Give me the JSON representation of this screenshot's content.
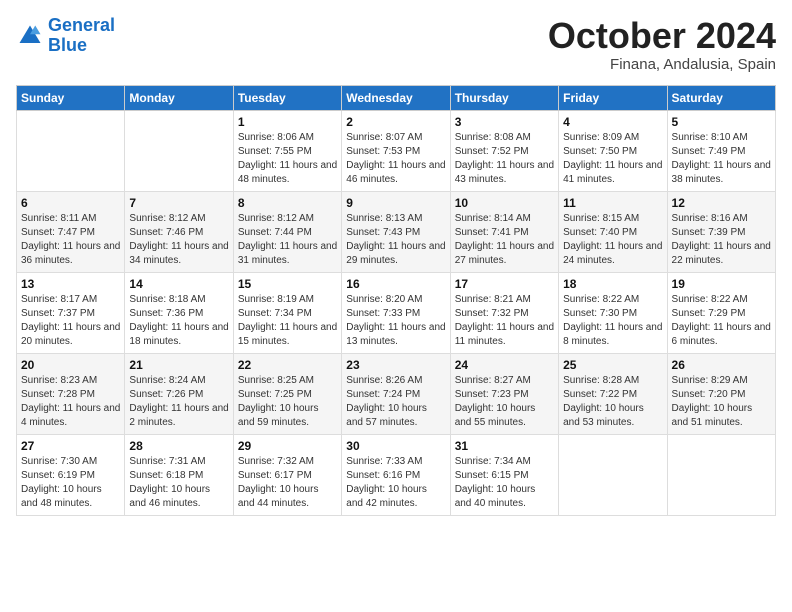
{
  "header": {
    "logo_line1": "General",
    "logo_line2": "Blue",
    "month": "October 2024",
    "location": "Finana, Andalusia, Spain"
  },
  "weekdays": [
    "Sunday",
    "Monday",
    "Tuesday",
    "Wednesday",
    "Thursday",
    "Friday",
    "Saturday"
  ],
  "weeks": [
    [
      {
        "day": "",
        "sunrise": "",
        "sunset": "",
        "daylight": ""
      },
      {
        "day": "",
        "sunrise": "",
        "sunset": "",
        "daylight": ""
      },
      {
        "day": "1",
        "sunrise": "Sunrise: 8:06 AM",
        "sunset": "Sunset: 7:55 PM",
        "daylight": "Daylight: 11 hours and 48 minutes."
      },
      {
        "day": "2",
        "sunrise": "Sunrise: 8:07 AM",
        "sunset": "Sunset: 7:53 PM",
        "daylight": "Daylight: 11 hours and 46 minutes."
      },
      {
        "day": "3",
        "sunrise": "Sunrise: 8:08 AM",
        "sunset": "Sunset: 7:52 PM",
        "daylight": "Daylight: 11 hours and 43 minutes."
      },
      {
        "day": "4",
        "sunrise": "Sunrise: 8:09 AM",
        "sunset": "Sunset: 7:50 PM",
        "daylight": "Daylight: 11 hours and 41 minutes."
      },
      {
        "day": "5",
        "sunrise": "Sunrise: 8:10 AM",
        "sunset": "Sunset: 7:49 PM",
        "daylight": "Daylight: 11 hours and 38 minutes."
      }
    ],
    [
      {
        "day": "6",
        "sunrise": "Sunrise: 8:11 AM",
        "sunset": "Sunset: 7:47 PM",
        "daylight": "Daylight: 11 hours and 36 minutes."
      },
      {
        "day": "7",
        "sunrise": "Sunrise: 8:12 AM",
        "sunset": "Sunset: 7:46 PM",
        "daylight": "Daylight: 11 hours and 34 minutes."
      },
      {
        "day": "8",
        "sunrise": "Sunrise: 8:12 AM",
        "sunset": "Sunset: 7:44 PM",
        "daylight": "Daylight: 11 hours and 31 minutes."
      },
      {
        "day": "9",
        "sunrise": "Sunrise: 8:13 AM",
        "sunset": "Sunset: 7:43 PM",
        "daylight": "Daylight: 11 hours and 29 minutes."
      },
      {
        "day": "10",
        "sunrise": "Sunrise: 8:14 AM",
        "sunset": "Sunset: 7:41 PM",
        "daylight": "Daylight: 11 hours and 27 minutes."
      },
      {
        "day": "11",
        "sunrise": "Sunrise: 8:15 AM",
        "sunset": "Sunset: 7:40 PM",
        "daylight": "Daylight: 11 hours and 24 minutes."
      },
      {
        "day": "12",
        "sunrise": "Sunrise: 8:16 AM",
        "sunset": "Sunset: 7:39 PM",
        "daylight": "Daylight: 11 hours and 22 minutes."
      }
    ],
    [
      {
        "day": "13",
        "sunrise": "Sunrise: 8:17 AM",
        "sunset": "Sunset: 7:37 PM",
        "daylight": "Daylight: 11 hours and 20 minutes."
      },
      {
        "day": "14",
        "sunrise": "Sunrise: 8:18 AM",
        "sunset": "Sunset: 7:36 PM",
        "daylight": "Daylight: 11 hours and 18 minutes."
      },
      {
        "day": "15",
        "sunrise": "Sunrise: 8:19 AM",
        "sunset": "Sunset: 7:34 PM",
        "daylight": "Daylight: 11 hours and 15 minutes."
      },
      {
        "day": "16",
        "sunrise": "Sunrise: 8:20 AM",
        "sunset": "Sunset: 7:33 PM",
        "daylight": "Daylight: 11 hours and 13 minutes."
      },
      {
        "day": "17",
        "sunrise": "Sunrise: 8:21 AM",
        "sunset": "Sunset: 7:32 PM",
        "daylight": "Daylight: 11 hours and 11 minutes."
      },
      {
        "day": "18",
        "sunrise": "Sunrise: 8:22 AM",
        "sunset": "Sunset: 7:30 PM",
        "daylight": "Daylight: 11 hours and 8 minutes."
      },
      {
        "day": "19",
        "sunrise": "Sunrise: 8:22 AM",
        "sunset": "Sunset: 7:29 PM",
        "daylight": "Daylight: 11 hours and 6 minutes."
      }
    ],
    [
      {
        "day": "20",
        "sunrise": "Sunrise: 8:23 AM",
        "sunset": "Sunset: 7:28 PM",
        "daylight": "Daylight: 11 hours and 4 minutes."
      },
      {
        "day": "21",
        "sunrise": "Sunrise: 8:24 AM",
        "sunset": "Sunset: 7:26 PM",
        "daylight": "Daylight: 11 hours and 2 minutes."
      },
      {
        "day": "22",
        "sunrise": "Sunrise: 8:25 AM",
        "sunset": "Sunset: 7:25 PM",
        "daylight": "Daylight: 10 hours and 59 minutes."
      },
      {
        "day": "23",
        "sunrise": "Sunrise: 8:26 AM",
        "sunset": "Sunset: 7:24 PM",
        "daylight": "Daylight: 10 hours and 57 minutes."
      },
      {
        "day": "24",
        "sunrise": "Sunrise: 8:27 AM",
        "sunset": "Sunset: 7:23 PM",
        "daylight": "Daylight: 10 hours and 55 minutes."
      },
      {
        "day": "25",
        "sunrise": "Sunrise: 8:28 AM",
        "sunset": "Sunset: 7:22 PM",
        "daylight": "Daylight: 10 hours and 53 minutes."
      },
      {
        "day": "26",
        "sunrise": "Sunrise: 8:29 AM",
        "sunset": "Sunset: 7:20 PM",
        "daylight": "Daylight: 10 hours and 51 minutes."
      }
    ],
    [
      {
        "day": "27",
        "sunrise": "Sunrise: 7:30 AM",
        "sunset": "Sunset: 6:19 PM",
        "daylight": "Daylight: 10 hours and 48 minutes."
      },
      {
        "day": "28",
        "sunrise": "Sunrise: 7:31 AM",
        "sunset": "Sunset: 6:18 PM",
        "daylight": "Daylight: 10 hours and 46 minutes."
      },
      {
        "day": "29",
        "sunrise": "Sunrise: 7:32 AM",
        "sunset": "Sunset: 6:17 PM",
        "daylight": "Daylight: 10 hours and 44 minutes."
      },
      {
        "day": "30",
        "sunrise": "Sunrise: 7:33 AM",
        "sunset": "Sunset: 6:16 PM",
        "daylight": "Daylight: 10 hours and 42 minutes."
      },
      {
        "day": "31",
        "sunrise": "Sunrise: 7:34 AM",
        "sunset": "Sunset: 6:15 PM",
        "daylight": "Daylight: 10 hours and 40 minutes."
      },
      {
        "day": "",
        "sunrise": "",
        "sunset": "",
        "daylight": ""
      },
      {
        "day": "",
        "sunrise": "",
        "sunset": "",
        "daylight": ""
      }
    ]
  ]
}
